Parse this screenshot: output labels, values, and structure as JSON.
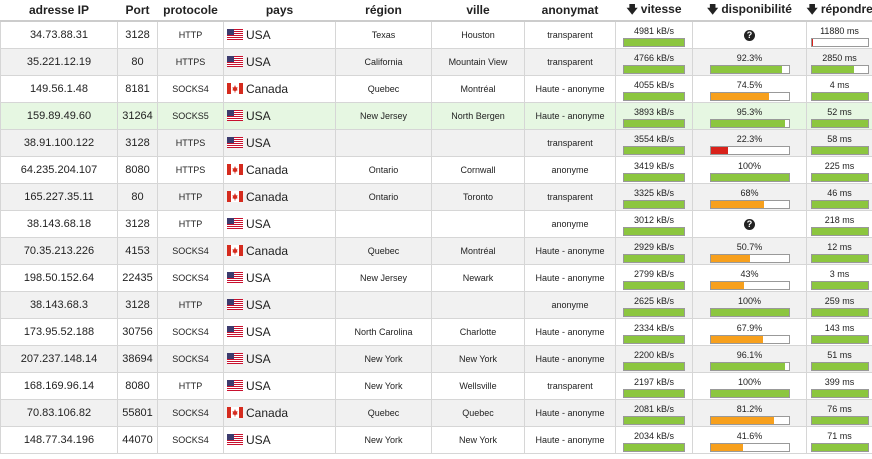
{
  "headers": [
    {
      "label": "adresse IP",
      "sort": false
    },
    {
      "label": "Port",
      "sort": false
    },
    {
      "label": "protocole",
      "sort": false
    },
    {
      "label": "pays",
      "sort": false
    },
    {
      "label": "région",
      "sort": false
    },
    {
      "label": "ville",
      "sort": false
    },
    {
      "label": "anonymat",
      "sort": false
    },
    {
      "label": "vitesse",
      "sort": true
    },
    {
      "label": "disponibilité",
      "sort": true
    },
    {
      "label": "répondre",
      "sort": true
    }
  ],
  "colors": {
    "green": "#8cc63f",
    "orange": "#f7a01d",
    "red": "#d9221b",
    "highlight": "#e6f7e2"
  },
  "rows": [
    {
      "ip": "34.73.88.31",
      "port": "3128",
      "protocol": "HTTP",
      "country": "USA",
      "region": "Texas",
      "city": "Houston",
      "anonymity": "transparent",
      "speed": "4981 kB/s",
      "speed_pct": 100,
      "avail": "",
      "avail_pct": null,
      "resp": "11880 ms",
      "resp_pct": 3,
      "resp_color": "red",
      "style": ""
    },
    {
      "ip": "35.221.12.19",
      "port": "80",
      "protocol": "HTTPS",
      "country": "USA",
      "region": "California",
      "city": "Mountain View",
      "anonymity": "transparent",
      "speed": "4766 kB/s",
      "speed_pct": 100,
      "avail": "92.3%",
      "avail_pct": 92.3,
      "resp": "2850 ms",
      "resp_pct": 75,
      "resp_color": "green",
      "style": "alt"
    },
    {
      "ip": "149.56.1.48",
      "port": "8181",
      "protocol": "SOCKS4",
      "country": "Canada",
      "region": "Quebec",
      "city": "Montréal",
      "anonymity": "Haute - anonyme",
      "speed": "4055 kB/s",
      "speed_pct": 100,
      "avail": "74.5%",
      "avail_pct": 74.5,
      "resp": "4 ms",
      "resp_pct": 100,
      "resp_color": "green",
      "style": ""
    },
    {
      "ip": "159.89.49.60",
      "port": "31264",
      "protocol": "SOCKS5",
      "country": "USA",
      "region": "New Jersey",
      "city": "North Bergen",
      "anonymity": "Haute - anonyme",
      "speed": "3893 kB/s",
      "speed_pct": 100,
      "avail": "95.3%",
      "avail_pct": 95.3,
      "resp": "52 ms",
      "resp_pct": 100,
      "resp_color": "green",
      "style": "hl"
    },
    {
      "ip": "38.91.100.122",
      "port": "3128",
      "protocol": "HTTPS",
      "country": "USA",
      "region": "",
      "city": "",
      "anonymity": "transparent",
      "speed": "3554 kB/s",
      "speed_pct": 100,
      "avail": "22.3%",
      "avail_pct": 22.3,
      "resp": "58 ms",
      "resp_pct": 100,
      "resp_color": "green",
      "style": "alt"
    },
    {
      "ip": "64.235.204.107",
      "port": "8080",
      "protocol": "HTTPS",
      "country": "Canada",
      "region": "Ontario",
      "city": "Cornwall",
      "anonymity": "anonyme",
      "speed": "3419 kB/s",
      "speed_pct": 100,
      "avail": "100%",
      "avail_pct": 100,
      "resp": "225 ms",
      "resp_pct": 100,
      "resp_color": "green",
      "style": ""
    },
    {
      "ip": "165.227.35.11",
      "port": "80",
      "protocol": "HTTP",
      "country": "Canada",
      "region": "Ontario",
      "city": "Toronto",
      "anonymity": "transparent",
      "speed": "3325 kB/s",
      "speed_pct": 100,
      "avail": "68%",
      "avail_pct": 68,
      "resp": "46 ms",
      "resp_pct": 100,
      "resp_color": "green",
      "style": "alt"
    },
    {
      "ip": "38.143.68.18",
      "port": "3128",
      "protocol": "HTTP",
      "country": "USA",
      "region": "",
      "city": "",
      "anonymity": "anonyme",
      "speed": "3012 kB/s",
      "speed_pct": 100,
      "avail": "",
      "avail_pct": null,
      "resp": "218 ms",
      "resp_pct": 100,
      "resp_color": "green",
      "style": ""
    },
    {
      "ip": "70.35.213.226",
      "port": "4153",
      "protocol": "SOCKS4",
      "country": "Canada",
      "region": "Quebec",
      "city": "Montréal",
      "anonymity": "Haute - anonyme",
      "speed": "2929 kB/s",
      "speed_pct": 100,
      "avail": "50.7%",
      "avail_pct": 50.7,
      "resp": "12 ms",
      "resp_pct": 100,
      "resp_color": "green",
      "style": "alt"
    },
    {
      "ip": "198.50.152.64",
      "port": "22435",
      "protocol": "SOCKS4",
      "country": "USA",
      "region": "New Jersey",
      "city": "Newark",
      "anonymity": "Haute - anonyme",
      "speed": "2799 kB/s",
      "speed_pct": 100,
      "avail": "43%",
      "avail_pct": 43,
      "resp": "3 ms",
      "resp_pct": 100,
      "resp_color": "green",
      "style": ""
    },
    {
      "ip": "38.143.68.3",
      "port": "3128",
      "protocol": "HTTP",
      "country": "USA",
      "region": "",
      "city": "",
      "anonymity": "anonyme",
      "speed": "2625 kB/s",
      "speed_pct": 100,
      "avail": "100%",
      "avail_pct": 100,
      "resp": "259 ms",
      "resp_pct": 100,
      "resp_color": "green",
      "style": "alt"
    },
    {
      "ip": "173.95.52.188",
      "port": "30756",
      "protocol": "SOCKS4",
      "country": "USA",
      "region": "North Carolina",
      "city": "Charlotte",
      "anonymity": "Haute - anonyme",
      "speed": "2334 kB/s",
      "speed_pct": 100,
      "avail": "67.9%",
      "avail_pct": 67.9,
      "resp": "143 ms",
      "resp_pct": 100,
      "resp_color": "green",
      "style": ""
    },
    {
      "ip": "207.237.148.14",
      "port": "38694",
      "protocol": "SOCKS4",
      "country": "USA",
      "region": "New York",
      "city": "New York",
      "anonymity": "Haute - anonyme",
      "speed": "2200 kB/s",
      "speed_pct": 100,
      "avail": "96.1%",
      "avail_pct": 96.1,
      "resp": "51 ms",
      "resp_pct": 100,
      "resp_color": "green",
      "style": "alt"
    },
    {
      "ip": "168.169.96.14",
      "port": "8080",
      "protocol": "HTTP",
      "country": "USA",
      "region": "New York",
      "city": "Wellsville",
      "anonymity": "transparent",
      "speed": "2197 kB/s",
      "speed_pct": 100,
      "avail": "100%",
      "avail_pct": 100,
      "resp": "399 ms",
      "resp_pct": 100,
      "resp_color": "green",
      "style": ""
    },
    {
      "ip": "70.83.106.82",
      "port": "55801",
      "protocol": "SOCKS4",
      "country": "Canada",
      "region": "Quebec",
      "city": "Quebec",
      "anonymity": "Haute - anonyme",
      "speed": "2081 kB/s",
      "speed_pct": 100,
      "avail": "81.2%",
      "avail_pct": 81.2,
      "resp": "76 ms",
      "resp_pct": 100,
      "resp_color": "green",
      "style": "alt"
    },
    {
      "ip": "148.77.34.196",
      "port": "44070",
      "protocol": "SOCKS4",
      "country": "USA",
      "region": "New York",
      "city": "New York",
      "anonymity": "Haute - anonyme",
      "speed": "2034 kB/s",
      "speed_pct": 100,
      "avail": "41.6%",
      "avail_pct": 41.6,
      "resp": "71 ms",
      "resp_pct": 100,
      "resp_color": "green",
      "style": ""
    }
  ]
}
